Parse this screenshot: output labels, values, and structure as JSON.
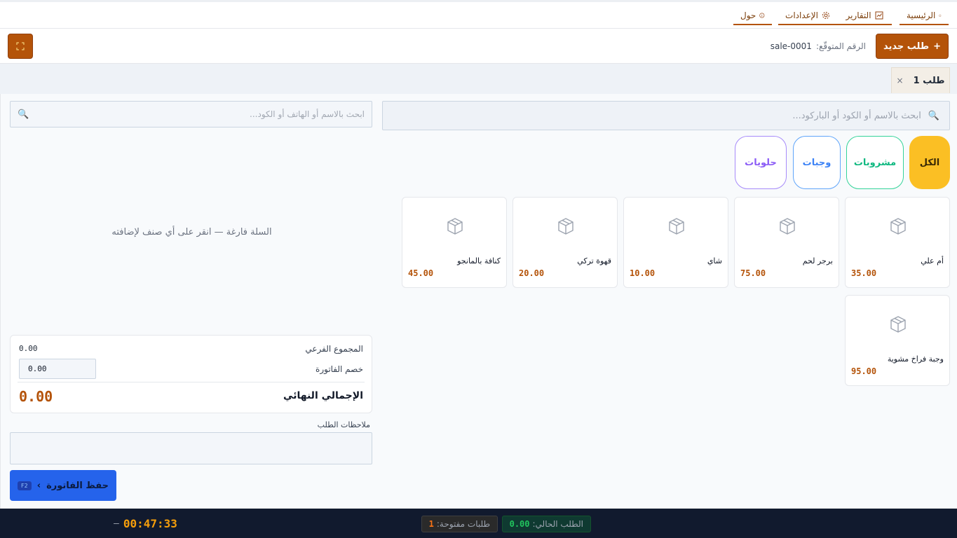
{
  "nav": {
    "tabs": [
      {
        "label": "الرئيسية",
        "icon": "home-icon"
      },
      {
        "label": "التقارير",
        "icon": "chart-icon"
      },
      {
        "label": "الإعدادات",
        "icon": "gear-icon"
      },
      {
        "label": "حول",
        "icon": "info-icon"
      }
    ]
  },
  "toolbar": {
    "new_order_label": "طلب جديد",
    "new_order_plus": "+",
    "expected_label": "الرقم المتوقّع:",
    "expected_value": "sale-0001"
  },
  "order_tabs": [
    {
      "label": "طلب 1",
      "close": "×"
    }
  ],
  "products": {
    "search_placeholder": "ابحث بالاسم أو الكود أو الباركود...",
    "categories": [
      {
        "label": "الكل",
        "color": "#fbbf24"
      },
      {
        "label": "مشروبات",
        "color": "#34d399"
      },
      {
        "label": "وجبات",
        "color": "#60a5fa"
      },
      {
        "label": "حلويات",
        "color": "#a78bfa"
      }
    ],
    "items": [
      {
        "name": "أم علي",
        "price": "35.00"
      },
      {
        "name": "برجر لحم",
        "price": "75.00"
      },
      {
        "name": "شاي",
        "price": "10.00"
      },
      {
        "name": "قهوة تركي",
        "price": "20.00"
      },
      {
        "name": "كنافة بالمانجو",
        "price": "45.00"
      },
      {
        "name": "وجبة فراخ مشوية",
        "price": "95.00"
      }
    ]
  },
  "cart": {
    "customer_search_placeholder": "ابحث بالاسم أو الهاتف أو الكود...",
    "empty_message": "السلة فارغة — انقر على أي صنف لإضافته",
    "subtotal_label": "المجموع الفرعي",
    "subtotal_value": "0.00",
    "discount_label": "خصم الفاتورة",
    "discount_value": "0.00",
    "grand_total_label": "الإجمالي النهائي",
    "grand_total_value": "0.00",
    "notes_label": "ملاحظات الطلب",
    "save_label": "حفظ الفاتورة",
    "save_chevron": "›",
    "save_shortcut": "F2"
  },
  "footer": {
    "current_label": "الطلب الحالي:",
    "current_value": "0.00",
    "open_label": "طلبات مفتوحة:",
    "open_value": "1",
    "clock": "00:47:33",
    "clock_dash": "—"
  },
  "colors": {
    "accent": "#b45309",
    "primary_button": "#2563eb",
    "footer_bg": "#111a2e"
  }
}
